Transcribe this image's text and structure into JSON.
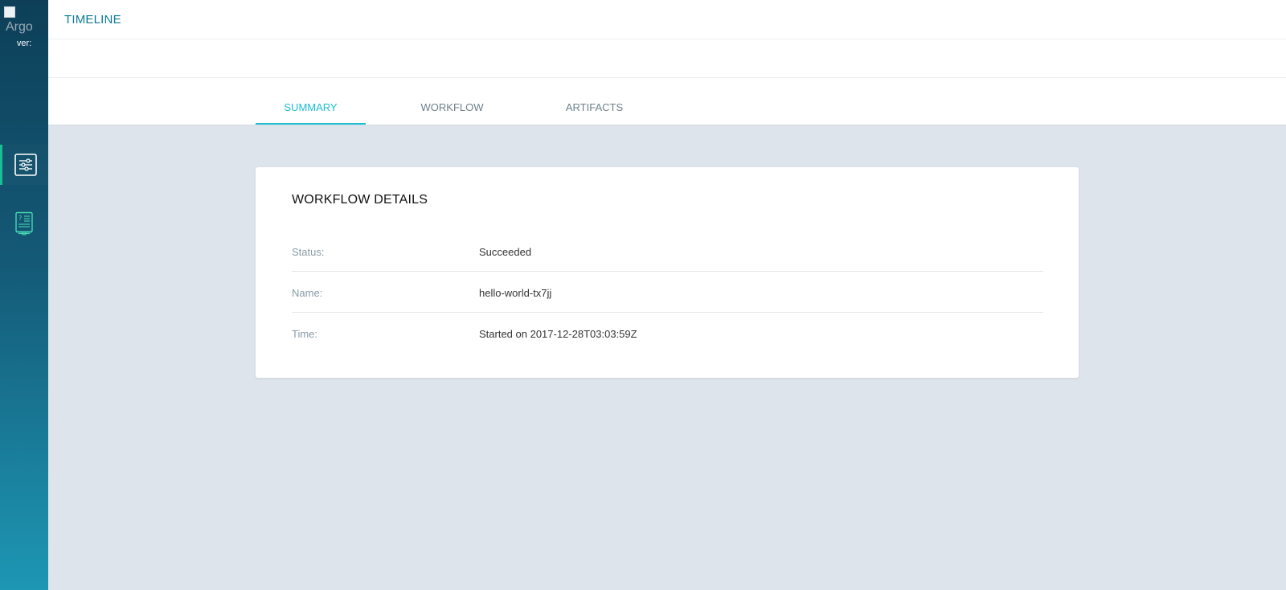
{
  "sidebar": {
    "logo_alt": "Argo",
    "version_label": "ver:",
    "items": [
      {
        "icon": "sliders-icon",
        "active": true
      },
      {
        "icon": "help-book-icon",
        "active": false
      }
    ]
  },
  "header": {
    "title": "TIMELINE"
  },
  "tabs": [
    {
      "label": "SUMMARY",
      "active": true
    },
    {
      "label": "WORKFLOW",
      "active": false
    },
    {
      "label": "ARTIFACTS",
      "active": false
    }
  ],
  "details": {
    "title": "WORKFLOW DETAILS",
    "rows": [
      {
        "key": "Status:",
        "value": "Succeeded"
      },
      {
        "key": "Name:",
        "value": "hello-world-tx7jj"
      },
      {
        "key": "Time:",
        "value": "Started on 2017-12-28T03:03:59Z"
      }
    ]
  },
  "colors": {
    "accent": "#1dbdd4",
    "title": "#0d7a96",
    "sidebar_top": "#0d3f58",
    "sidebar_bottom": "#1d97b4"
  }
}
